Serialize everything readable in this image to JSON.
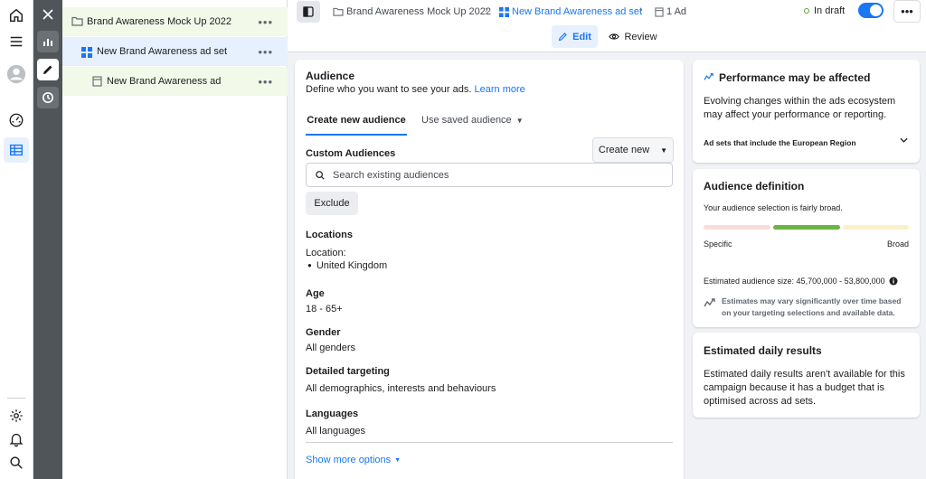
{
  "tree": {
    "campaign_label": "Brand Awareness Mock Up 2022",
    "adset_label": "New Brand Awareness ad set",
    "ad_label": "New Brand Awareness ad",
    "more": "•••"
  },
  "topbar": {
    "breadcrumb_campaign": "Brand Awareness Mock Up 2022",
    "breadcrumb_adset": "New Brand Awareness ad set",
    "breadcrumb_ad": "1 Ad",
    "status": "In draft",
    "status_toggle_on": true,
    "more": "•••",
    "tab_edit": "Edit",
    "tab_review": "Review"
  },
  "audience": {
    "title": "Audience",
    "description": "Define who you want to see your ads.",
    "learn_more": "Learn more",
    "tab_create": "Create new audience",
    "tab_saved": "Use saved audience",
    "custom_label": "Custom Audiences",
    "create_new": "Create new",
    "search_placeholder": "Search existing audiences",
    "exclude": "Exclude",
    "locations_label": "Locations",
    "location_prefix": "Location:",
    "location_value": "United Kingdom",
    "age_label": "Age",
    "age_value": "18 - 65+",
    "gender_label": "Gender",
    "gender_value": "All genders",
    "detailed_label": "Detailed targeting",
    "detailed_value": "All demographics, interests and behaviours",
    "languages_label": "Languages",
    "languages_value": "All languages",
    "show_more": "Show more options"
  },
  "performance": {
    "title": "Performance may be affected",
    "text": "Evolving changes within the ads ecosystem may affect your performance or reporting.",
    "region_row": "Ad sets that include the European Region"
  },
  "definition": {
    "title": "Audience definition",
    "text": "Your audience selection is fairly broad.",
    "specific": "Specific",
    "broad": "Broad",
    "size": "Estimated audience size: 45,700,000 - 53,800,000",
    "note": "Estimates may vary significantly over time based on your targeting selections and available data.",
    "meter_colors": [
      "#f9dcd9",
      "#6ab53f",
      "#fcefc9"
    ]
  },
  "daily": {
    "title": "Estimated daily results",
    "text": "Estimated daily results aren't available for this campaign because it has a budget that is optimised across ad sets."
  },
  "colors": {
    "accent": "#1877f2",
    "draft_status": "#5ea034",
    "tree_campaign_bg": "#f2f9e8",
    "tree_adset_bg": "#e7f0fd"
  }
}
